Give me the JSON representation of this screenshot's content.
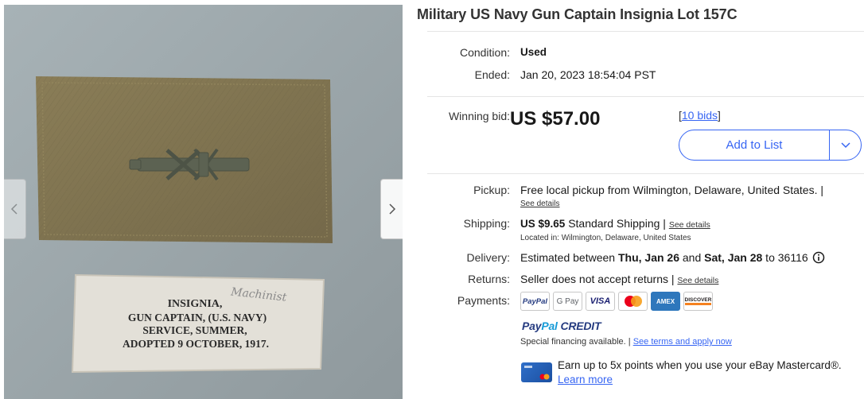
{
  "listing": {
    "title": "Military US Navy Gun Captain Insignia Lot 157C",
    "condition_label": "Condition:",
    "condition_value": "Used",
    "ended_label": "Ended:",
    "ended_value": "Jan 20, 2023 18:54:04 PST"
  },
  "bid": {
    "winning_label": "Winning bid:",
    "price": "US $57.00",
    "bids_open": "[",
    "bids_link": "10 bids",
    "bids_close": "]",
    "add_to_list": "Add to List"
  },
  "photo": {
    "label_lines": [
      "INSIGNIA,",
      "GUN CAPTAIN, (U.S. NAVY)",
      "SERVICE, SUMMER,",
      "ADOPTED 9 OCTOBER, 1917."
    ],
    "handwriting": "Machinist"
  },
  "pickup": {
    "label": "Pickup:",
    "value": "Free local pickup from Wilmington, Delaware, United States.",
    "sep": " |",
    "see_details": "See details"
  },
  "shipping": {
    "label": "Shipping:",
    "price": "US $9.65",
    "method": "Standard Shipping",
    "sep": " | ",
    "see_details": "See details",
    "location": "Located in: Wilmington, Delaware, United States"
  },
  "delivery": {
    "label": "Delivery:",
    "prefix": "Estimated between ",
    "start": "Thu, Jan 26",
    "mid": " and ",
    "end": "Sat, Jan 28",
    "suffix": " to 36116",
    "info_icon": "info-icon"
  },
  "returns": {
    "label": "Returns:",
    "value": "Seller does not accept returns",
    "sep": " | ",
    "see_details": "See details"
  },
  "payments": {
    "label": "Payments:",
    "methods": [
      "PayPal",
      "G Pay",
      "VISA",
      "Mastercard",
      "AMEX",
      "DISCOVER"
    ],
    "paypal_credit": [
      "PayPal",
      "Pal",
      "CREDIT"
    ],
    "financing_text": "Special financing available.",
    "financing_sep": " | ",
    "financing_link": "See terms and apply now",
    "ebay_mastercard_text": "Earn up to 5x points when you use your eBay Mastercard®.",
    "learn_more": "Learn more"
  },
  "colors": {
    "accent": "#3665f3",
    "text": "#191919",
    "divider": "#e5e5e5"
  }
}
